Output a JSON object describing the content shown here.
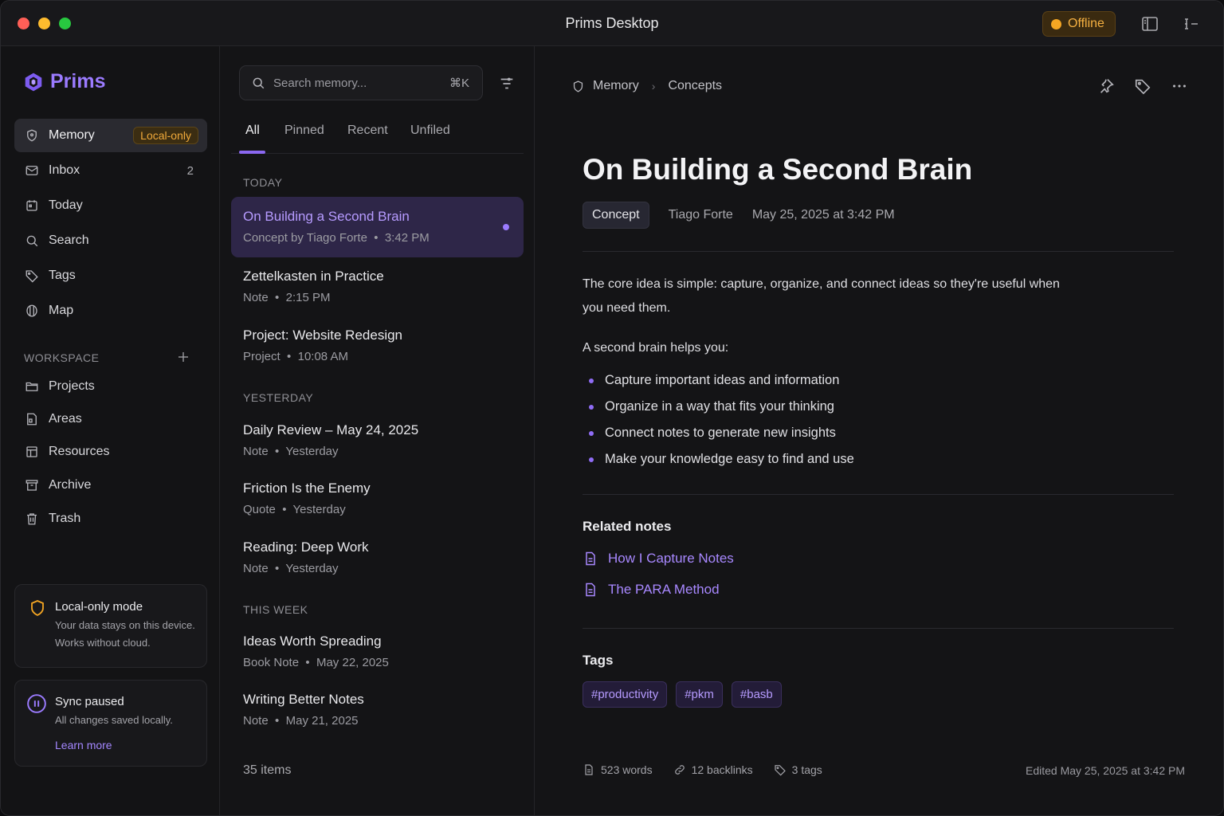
{
  "window": {
    "title": "Prims Desktop",
    "status": "Offline"
  },
  "colors": {
    "accent": "#9b7bff",
    "warning": "#f5a623",
    "background": "#141416"
  },
  "sidebar": {
    "brand": "Prims",
    "items": [
      {
        "label": "Memory",
        "icon": "shield-icon",
        "badge": "Local-only",
        "active": true
      },
      {
        "label": "Inbox",
        "icon": "mail-icon",
        "count": "2"
      },
      {
        "label": "Today",
        "icon": "calendar-icon"
      },
      {
        "label": "Search",
        "icon": "search-icon"
      },
      {
        "label": "Tags",
        "icon": "tag-icon"
      },
      {
        "label": "Map",
        "icon": "map-icon"
      }
    ],
    "workspace_label": "WORKSPACE",
    "workspace": [
      {
        "label": "Projects",
        "icon": "folder-icon"
      },
      {
        "label": "Areas",
        "icon": "layers-icon"
      },
      {
        "label": "Resources",
        "icon": "book-icon"
      },
      {
        "label": "Archive",
        "icon": "archive-icon"
      },
      {
        "label": "Trash",
        "icon": "trash-icon"
      }
    ],
    "local_card": {
      "title": "Local-only mode",
      "text": "Your data stays on this device. Works without cloud."
    },
    "sync_card": {
      "title": "Sync paused",
      "text": "All changes saved locally.",
      "link": "Learn more"
    }
  },
  "list": {
    "search_placeholder": "Search memory...",
    "shortcut": "⌘K",
    "tabs": [
      "All",
      "Pinned",
      "Recent",
      "Unfiled"
    ],
    "groups": [
      {
        "label": "TODAY",
        "items": [
          {
            "title": "On Building a Second Brain",
            "type": "Concept by Tiago Forte",
            "time": "3:42 PM",
            "selected": true
          },
          {
            "title": "Zettelkasten in Practice",
            "type": "Note",
            "time": "2:15 PM"
          },
          {
            "title": "Project: Website Redesign",
            "type": "Project",
            "time": "10:08 AM"
          }
        ]
      },
      {
        "label": "YESTERDAY",
        "items": [
          {
            "title": "Daily Review – May 24, 2025",
            "type": "Note",
            "time": "Yesterday"
          },
          {
            "title": "Friction Is the Enemy",
            "type": "Quote",
            "time": "Yesterday"
          },
          {
            "title": "Reading: Deep Work",
            "type": "Note",
            "time": "Yesterday"
          }
        ]
      },
      {
        "label": "THIS WEEK",
        "items": [
          {
            "title": "Ideas Worth Spreading",
            "type": "Book Note",
            "time": "May 22, 2025"
          },
          {
            "title": "Writing Better Notes",
            "type": "Note",
            "time": "May 21, 2025"
          }
        ]
      }
    ],
    "count": "35 items"
  },
  "detail": {
    "breadcrumb": [
      "Memory",
      "Concepts"
    ],
    "title": "On Building a Second Brain",
    "type": "Concept",
    "author": "Tiago Forte",
    "date": "May 25, 2025 at 3:42 PM",
    "intro": "The core idea is simple: capture, organize, and connect ideas so they're useful when you need them.",
    "lead": "A second brain helps you:",
    "bullets": [
      "Capture important ideas and information",
      "Organize in a way that fits your thinking",
      "Connect notes to generate new insights",
      "Make your knowledge easy to find and use"
    ],
    "related_heading": "Related notes",
    "related": [
      "How I Capture Notes",
      "The PARA Method"
    ],
    "tags_heading": "Tags",
    "tags": [
      "#productivity",
      "#pkm",
      "#basb"
    ],
    "footer": {
      "words": "523 words",
      "backlinks": "12 backlinks",
      "tags": "3 tags",
      "edited": "Edited May 25, 2025 at 3:42 PM"
    }
  }
}
